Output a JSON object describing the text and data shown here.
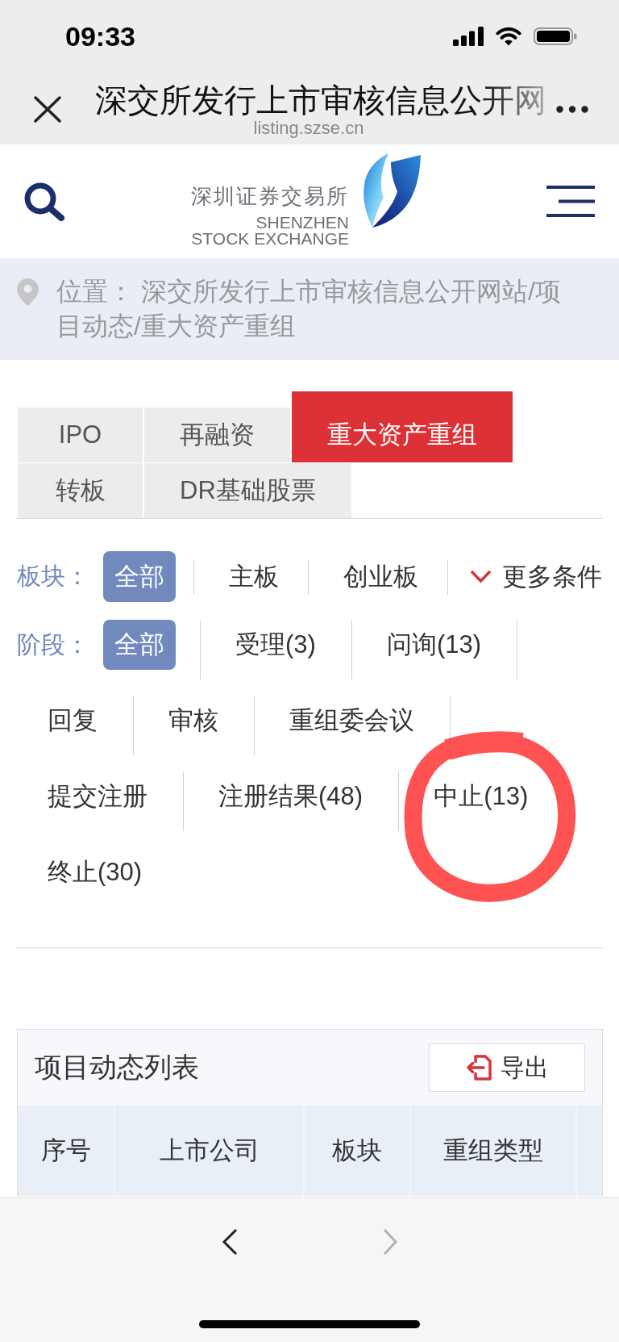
{
  "status_bar": {
    "time": "09:33"
  },
  "browser_header": {
    "title": "深交所发行上市审核信息公开网",
    "url": "listing.szse.cn"
  },
  "site_header": {
    "logo_cn": "深圳证券交易所",
    "logo_en_1": "SHENZHEN",
    "logo_en_2": "STOCK EXCHANGE"
  },
  "breadcrumb": {
    "label": "位置：",
    "path": "深交所发行上市审核信息公开网站/项目动态/重大资产重组"
  },
  "tabs": [
    {
      "label": "IPO",
      "selected": false
    },
    {
      "label": "再融资",
      "selected": false
    },
    {
      "label": "重大资产重组",
      "selected": true
    },
    {
      "label": "转板",
      "selected": false
    },
    {
      "label": "DR基础股票",
      "selected": false
    }
  ],
  "filters": {
    "board": {
      "label": "板块：",
      "options": [
        {
          "label": "全部",
          "selected": true
        },
        {
          "label": "主板",
          "selected": false
        },
        {
          "label": "创业板",
          "selected": false
        }
      ],
      "more": "更多条件"
    },
    "stage": {
      "label": "阶段：",
      "options": [
        {
          "label": "全部",
          "selected": true,
          "circled": false
        },
        {
          "label": "受理(3)",
          "selected": false,
          "circled": false
        },
        {
          "label": "问询(13)",
          "selected": false,
          "circled": false
        },
        {
          "label": "回复",
          "selected": false,
          "circled": false
        },
        {
          "label": "审核",
          "selected": false,
          "circled": false
        },
        {
          "label": "重组委会议",
          "selected": false,
          "circled": false
        },
        {
          "label": "提交注册",
          "selected": false,
          "circled": false
        },
        {
          "label": "注册结果(48)",
          "selected": false,
          "circled": false
        },
        {
          "label": "中止(13)",
          "selected": false,
          "circled": true
        },
        {
          "label": "终止(30)",
          "selected": false,
          "circled": false
        }
      ]
    }
  },
  "project_list": {
    "title": "项目动态列表",
    "export_button": "导出",
    "columns": [
      "序号",
      "上市公司",
      "板块",
      "重组类型"
    ]
  },
  "nav_buttons": [
    {
      "kind": "back",
      "disabled": false
    },
    {
      "kind": "forward",
      "disabled": true
    }
  ]
}
